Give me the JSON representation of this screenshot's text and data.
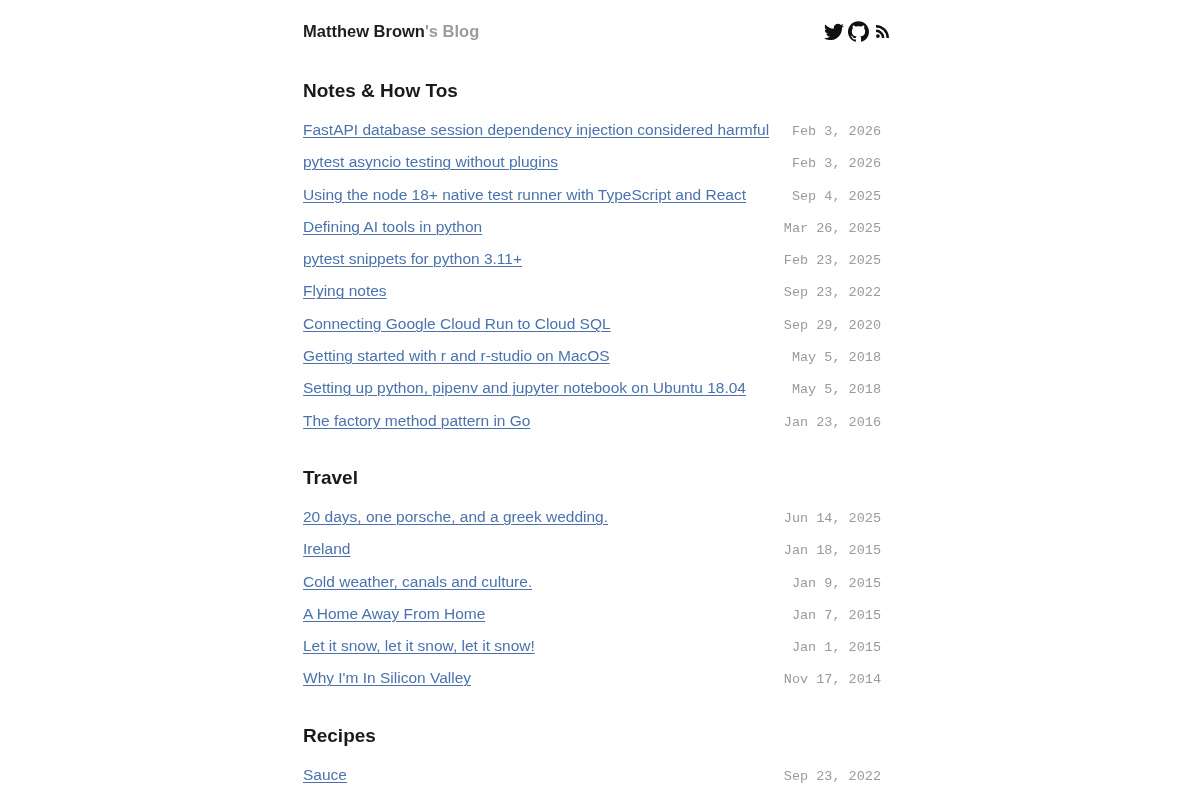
{
  "header": {
    "title": {
      "main": "Matthew Brown",
      "suffix": "'s Blog"
    }
  },
  "sections": [
    {
      "heading": "Notes & How Tos",
      "posts": [
        {
          "title": "FastAPI database session dependency injection considered harmful",
          "date": "Feb 3, 2026"
        },
        {
          "title": "pytest asyncio testing without plugins",
          "date": "Feb 3, 2026"
        },
        {
          "title": "Using the node 18+ native test runner with TypeScript and React",
          "date": "Sep 4, 2025"
        },
        {
          "title": "Defining AI tools in python",
          "date": "Mar 26, 2025"
        },
        {
          "title": "pytest snippets for python 3.11+",
          "date": "Feb 23, 2025"
        },
        {
          "title": "Flying notes",
          "date": "Sep 23, 2022"
        },
        {
          "title": "Connecting Google Cloud Run to Cloud SQL",
          "date": "Sep 29, 2020"
        },
        {
          "title": "Getting started with r and r-studio on MacOS",
          "date": "May 5, 2018"
        },
        {
          "title": "Setting up python, pipenv and jupyter notebook on Ubuntu 18.04",
          "date": "May 5, 2018"
        },
        {
          "title": "The factory method pattern in Go",
          "date": "Jan 23, 2016"
        }
      ]
    },
    {
      "heading": "Travel",
      "posts": [
        {
          "title": "20 days, one porsche, and a greek wedding.",
          "date": "Jun 14, 2025"
        },
        {
          "title": "Ireland",
          "date": "Jan 18, 2015"
        },
        {
          "title": "Cold weather, canals and culture.",
          "date": "Jan 9, 2015"
        },
        {
          "title": "A Home Away From Home",
          "date": "Jan 7, 2015"
        },
        {
          "title": "Let it snow, let it snow, let it snow!",
          "date": "Jan 1, 2015"
        },
        {
          "title": "Why I'm In Silicon Valley",
          "date": "Nov 17, 2014"
        }
      ]
    },
    {
      "heading": "Recipes",
      "posts": [
        {
          "title": "Sauce",
          "date": "Sep 23, 2022"
        }
      ]
    }
  ]
}
